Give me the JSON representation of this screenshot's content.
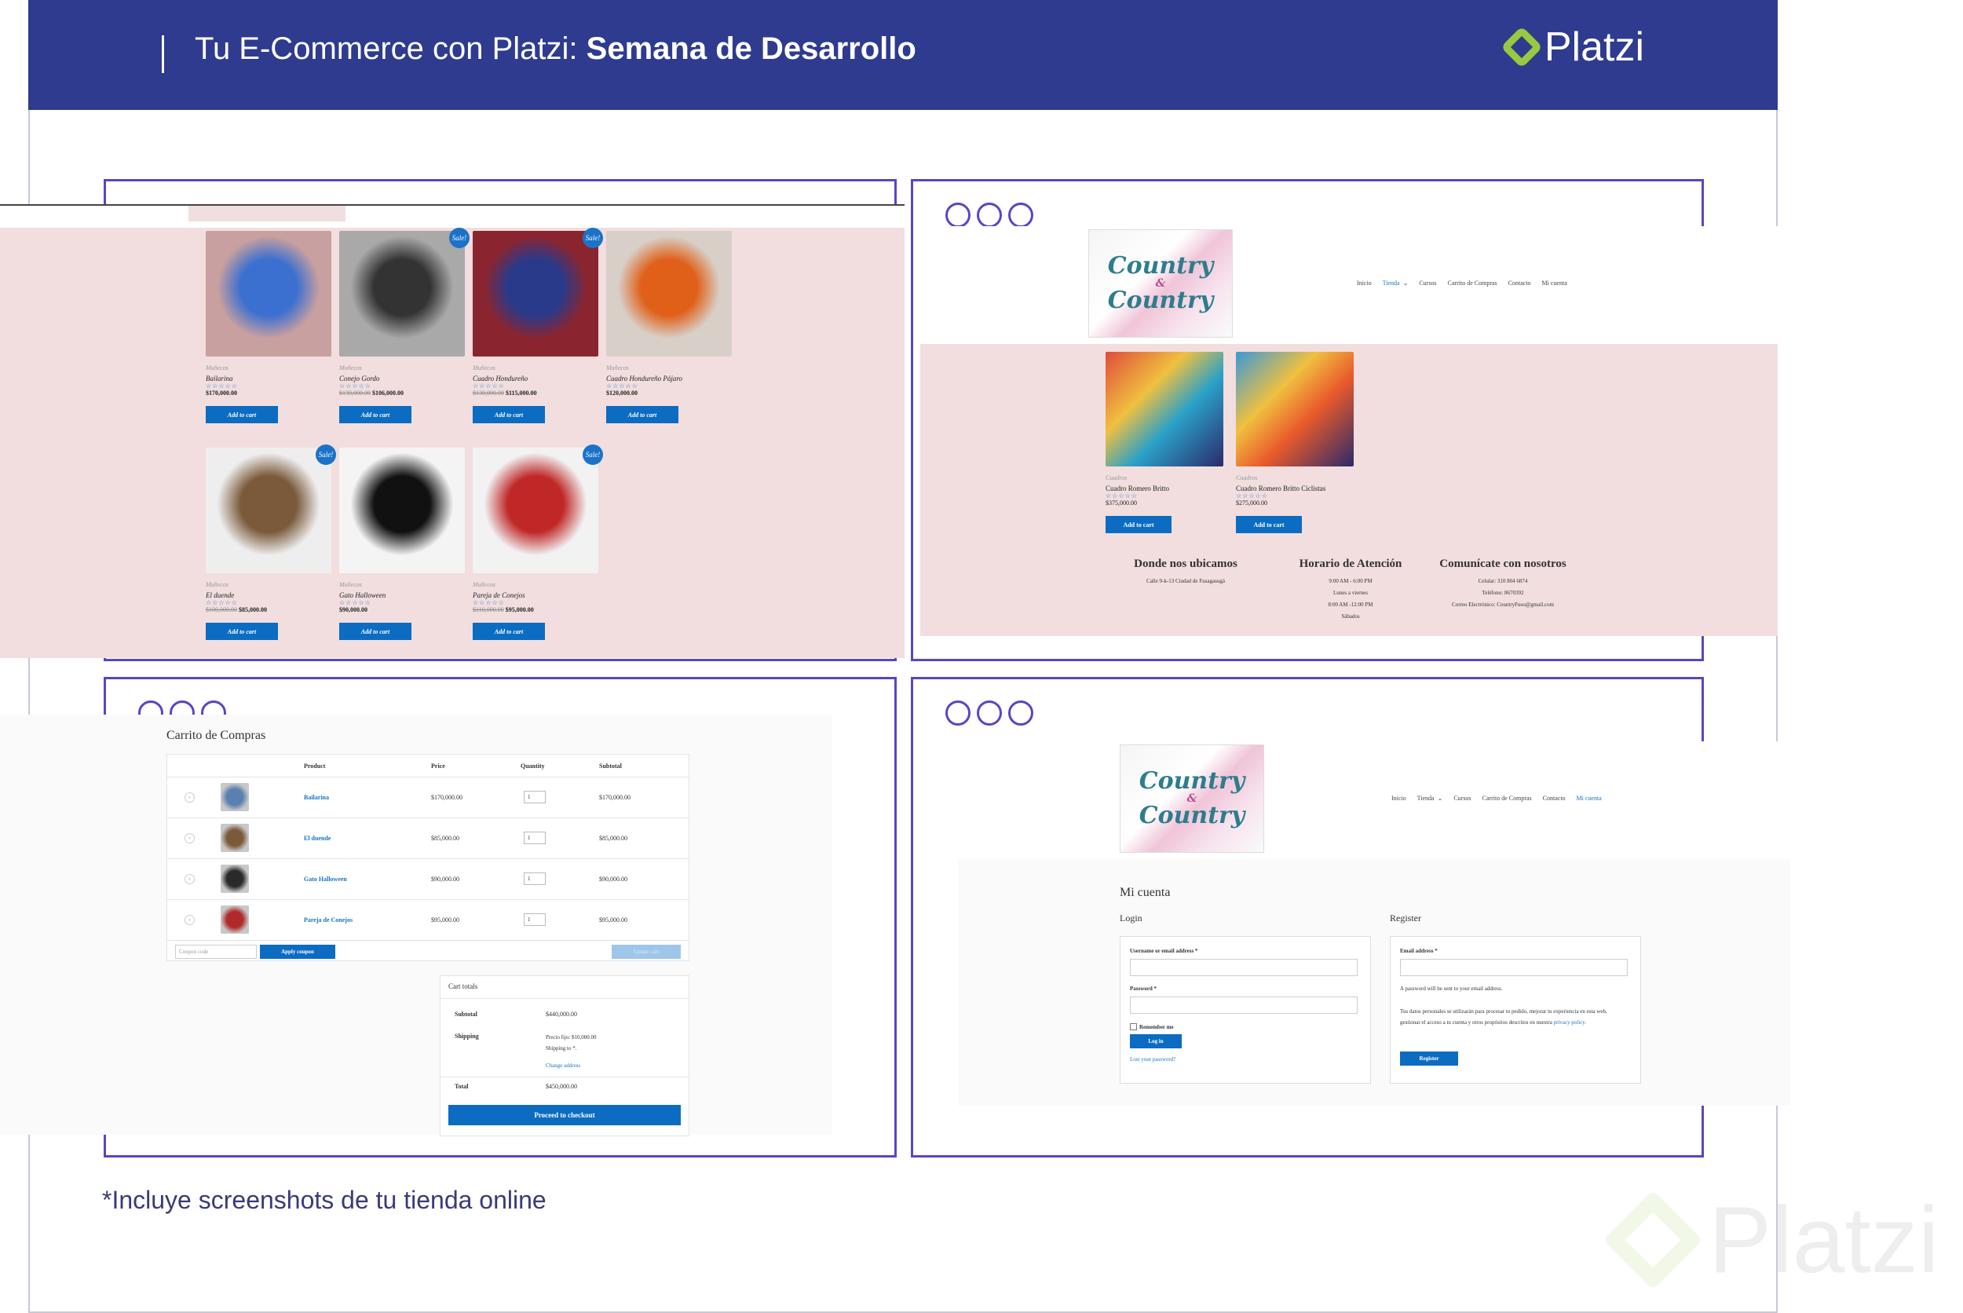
{
  "banner": {
    "title_prefix": "Tu E-Commerce con Platzi: ",
    "title_bold": "Semana de Desarrollo",
    "logo_text": "Platzi"
  },
  "shop_panel": {
    "row1": [
      {
        "cat": "Muñecos",
        "name": "Bailarina",
        "old": "",
        "price": "$170,000.00",
        "sale": false,
        "colors": [
          "#c9a0a0",
          "#3b6fd0"
        ]
      },
      {
        "cat": "Muñecos",
        "name": "Conejo Gordo",
        "old": "$130,000.00",
        "price": "$106,000.00",
        "sale": true,
        "colors": [
          "#a9a9a9",
          "#333"
        ]
      },
      {
        "cat": "Muñecos",
        "name": "Cuadro Hondureño",
        "old": "$130,000.00",
        "price": "$115,000.00",
        "sale": true,
        "colors": [
          "#8a2530",
          "#2a3a8a"
        ]
      },
      {
        "cat": "Muñecos",
        "name": "Cuadro Hondureño Pájaro",
        "old": "",
        "price": "$120,000.00",
        "sale": false,
        "colors": [
          "#d8d0c8",
          "#e0601a"
        ]
      }
    ],
    "row2": [
      {
        "cat": "Muñecos",
        "name": "El duende",
        "old": "$100,000.00",
        "price": "$85,000.00",
        "sale": true,
        "colors": [
          "#eee",
          "#7a5a3a"
        ]
      },
      {
        "cat": "Muñecos",
        "name": "Gato Halloween",
        "old": "",
        "price": "$90,000.00",
        "sale": false,
        "colors": [
          "#f4f4f4",
          "#111"
        ]
      },
      {
        "cat": "Muñecos",
        "name": "Pareja de Conejos",
        "old": "$110,000.00",
        "price": "$95,000.00",
        "sale": true,
        "colors": [
          "#f2f2f2",
          "#c02828"
        ]
      }
    ],
    "add_to_cart": "Add to cart",
    "stars": "☆☆☆☆☆",
    "sale": "Sale!"
  },
  "tienda_panel": {
    "logo_line1": "Country",
    "logo_amp": "&",
    "logo_line2": "Country",
    "nav": [
      "Inicio",
      "Tienda",
      "Cursos",
      "Carrito de Compras",
      "Contacto",
      "Mi cuenta"
    ],
    "nav_chevron": "⌄",
    "products": [
      {
        "cat": "Cuadros",
        "name": "Cuadro Romero Britto",
        "price": "$375,000.00",
        "colors": [
          "#e04c3a",
          "#2aa0c8"
        ]
      },
      {
        "cat": "Cuadros",
        "name": "Cuadro Romero Britto Ciclistas",
        "price": "$275,000.00",
        "colors": [
          "#3a9ad8",
          "#e85a2a"
        ]
      }
    ],
    "footer": [
      {
        "h": "Donde nos ubicamos",
        "lines": [
          "Calle 9-k-13 Ciudad de Fusagasugá"
        ]
      },
      {
        "h": "Horario de Atención",
        "lines": [
          "9:00 AM - 6:00 PM",
          "Lunes a viernes",
          "8:00 AM -12:00 PM",
          "Sábados"
        ]
      },
      {
        "h": "Comunícate con nosotros",
        "lines": [
          "Celular: 310 804 6874",
          "Teléfono: 8670392",
          "Correo Electrónico: CountryFuso@gmail.com"
        ]
      }
    ]
  },
  "cart_panel": {
    "title": "Carrito de Compras",
    "headers": [
      "Product",
      "Price",
      "Quantity",
      "Subtotal"
    ],
    "rows": [
      {
        "name": "Bailarina",
        "price": "$170,000.00",
        "qty": "1",
        "subtotal": "$170,000.00",
        "color": "#5a80b0"
      },
      {
        "name": "El duende",
        "price": "$85,000.00",
        "qty": "1",
        "subtotal": "$85,000.00",
        "color": "#7a5a3a"
      },
      {
        "name": "Gato Halloween",
        "price": "$90,000.00",
        "qty": "1",
        "subtotal": "$90,000.00",
        "color": "#2a2a2a"
      },
      {
        "name": "Pareja de Conejos",
        "price": "$95,000.00",
        "qty": "1",
        "subtotal": "$95,000.00",
        "color": "#b02a2a"
      }
    ],
    "remove": "×",
    "coupon_placeholder": "Coupon code",
    "apply": "Apply coupon",
    "update": "Update cart",
    "totals_title": "Cart totals",
    "subtotal_label": "Subtotal",
    "subtotal": "$440,000.00",
    "shipping_label": "Shipping",
    "shipping_line1": "Precio fijo: $10,000.00",
    "shipping_line2": "Shipping to *.",
    "change_address": "Change address",
    "total_label": "Total",
    "total": "$450,000.00",
    "checkout": "Proceed to checkout"
  },
  "account_panel": {
    "nav": [
      "Inicio",
      "Tienda",
      "Cursos",
      "Carrito de Compras",
      "Contacto",
      "Mi cuenta"
    ],
    "title": "Mi cuenta",
    "login": "Login",
    "register": "Register",
    "user_label": "Username or email address *",
    "pass_label": "Password *",
    "remember": "Remember me",
    "login_btn": "Log in",
    "lost": "Lost your password?",
    "email_label": "Email address *",
    "reg_note": "A password will be sent to your email address.",
    "privacy_text": "Tus datos personales se utilizarán para procesar tu pedido, mejorar tu experiencia en esta web, gestionar el acceso a tu cuenta y otros propósitos descritos en nuestra",
    "privacy_link": "privacy policy.",
    "register_btn": "Register"
  },
  "footnote": "*Incluye screenshots de tu tienda online",
  "watermark": "Platzi"
}
